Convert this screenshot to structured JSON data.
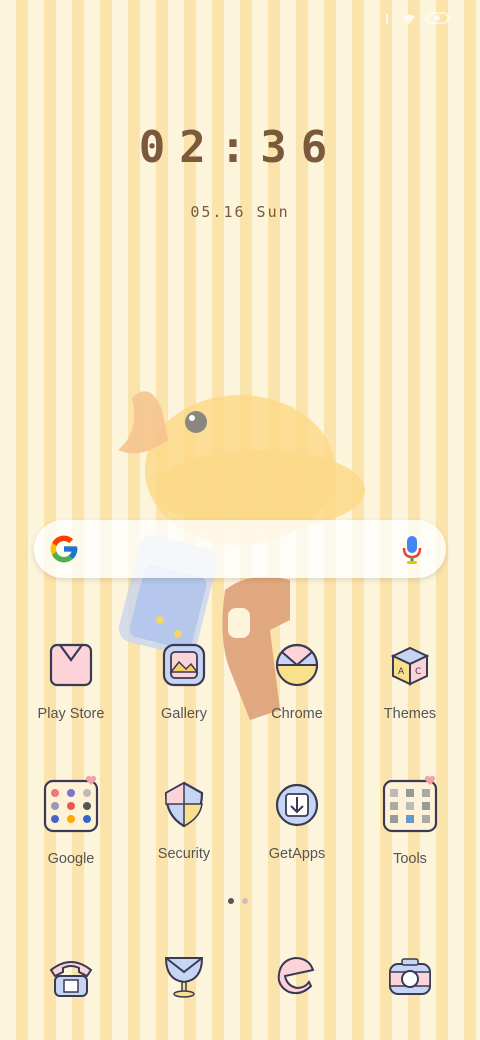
{
  "status_bar": {
    "icons": [
      "signal-icon",
      "wifi-icon",
      "battery-icon"
    ]
  },
  "clock": {
    "time": "02:36",
    "date": "05.16 Sun"
  },
  "search": {
    "icons": [
      "google-g-icon",
      "microphone-icon"
    ]
  },
  "apps_row1": [
    {
      "label": "Play Store",
      "icon": "play-store-icon"
    },
    {
      "label": "Gallery",
      "icon": "gallery-icon"
    },
    {
      "label": "Chrome",
      "icon": "chrome-icon"
    },
    {
      "label": "Themes",
      "icon": "themes-icon"
    }
  ],
  "apps_row2": [
    {
      "label": "Google",
      "icon": "google-folder-icon"
    },
    {
      "label": "Security",
      "icon": "security-icon"
    },
    {
      "label": "GetApps",
      "icon": "getapps-icon"
    },
    {
      "label": "Tools",
      "icon": "tools-folder-icon"
    }
  ],
  "page_indicator": {
    "count": 2,
    "active": 0
  },
  "dock": [
    {
      "icon": "phone-icon"
    },
    {
      "icon": "messages-icon"
    },
    {
      "icon": "browser-icon"
    },
    {
      "icon": "camera-icon"
    }
  ],
  "colors": {
    "clock_text": "#7a5a3a",
    "stripe_light": "#fdf4dc",
    "stripe_dark": "#fbe3ac"
  }
}
